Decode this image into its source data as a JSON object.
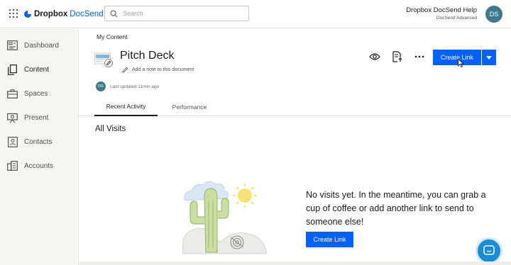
{
  "header": {
    "brand_primary": "Dropbox",
    "brand_secondary": "DocSend",
    "search_placeholder": "Search",
    "help_title": "Dropbox DocSend Help",
    "help_subtitle": "DocSend Advanced",
    "avatar_initials": "DS",
    "accent_color": "#0061fe"
  },
  "sidebar": {
    "items": [
      {
        "label": "Dashboard",
        "icon": "dashboard-icon"
      },
      {
        "label": "Content",
        "icon": "content-icon"
      },
      {
        "label": "Spaces",
        "icon": "spaces-icon"
      },
      {
        "label": "Present",
        "icon": "present-icon"
      },
      {
        "label": "Contacts",
        "icon": "contacts-icon"
      },
      {
        "label": "Accounts",
        "icon": "accounts-icon"
      }
    ],
    "active": "Content"
  },
  "main": {
    "breadcrumb": "My Content",
    "doc_title": "Pitch Deck",
    "add_note": "Add a note to this document",
    "updater_initials": "DS",
    "last_updated": "Last updated 11min ago",
    "create_link_label": "Create Link",
    "tabs": [
      {
        "label": "Recent Activity",
        "active": true
      },
      {
        "label": "Performance",
        "active": false
      }
    ],
    "section_title": "All Visits",
    "empty_message": "No visits yet. In the meantime, you can grab a cup of coffee or add another link to send to someone else!",
    "empty_button_label": "Create Link"
  }
}
